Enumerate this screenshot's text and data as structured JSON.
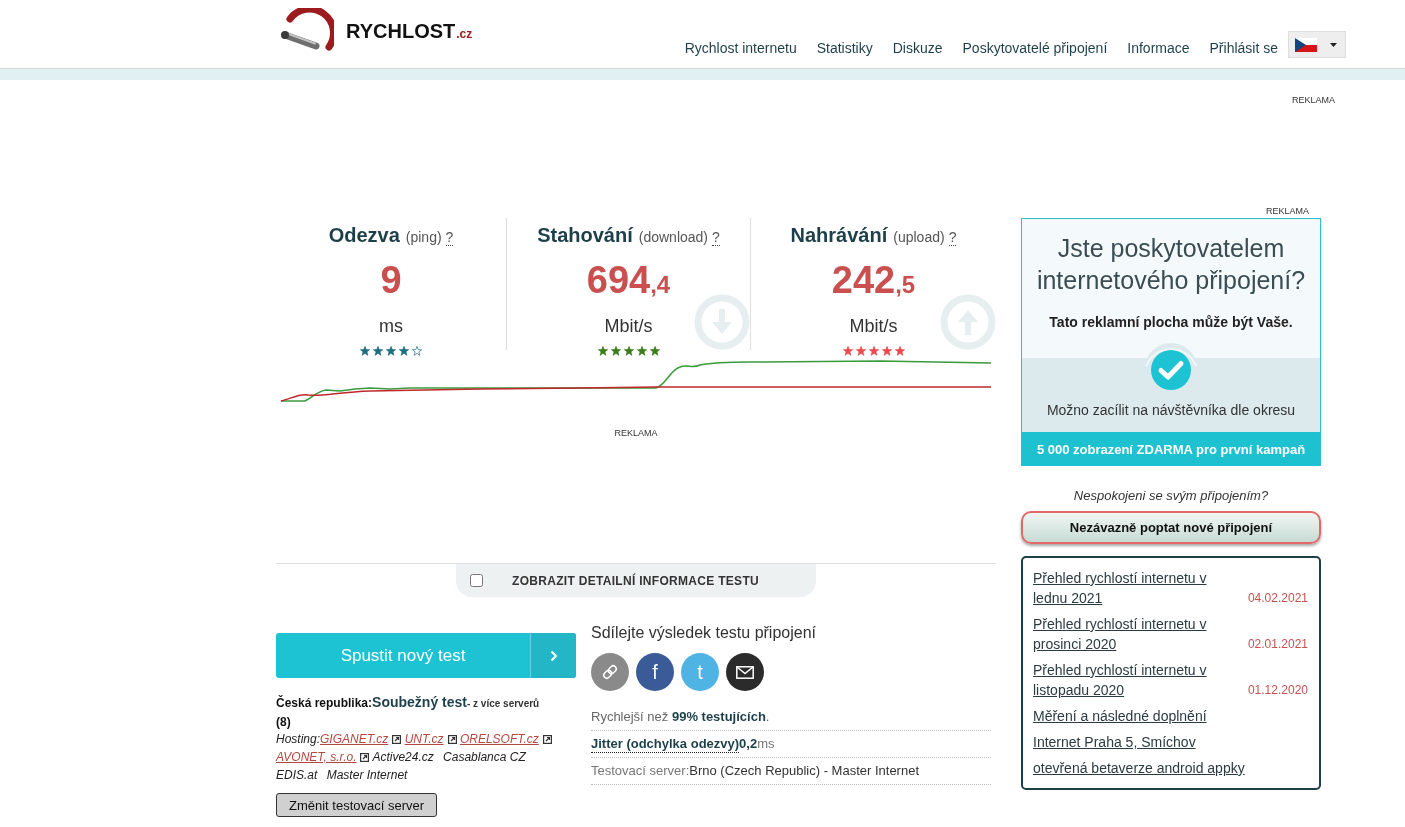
{
  "header": {
    "logo": "RYCHLOST",
    "logo_domain": ".cz",
    "nav": [
      "Rychlost internetu",
      "Statistiky",
      "Diskuze",
      "Poskytovatelé připojení",
      "Informace",
      "Přihlásit se"
    ]
  },
  "top_ad": {
    "label": "REKLAMA"
  },
  "metrics": [
    {
      "kind": "ping",
      "title": "Odezva",
      "subtitle": "(ping)",
      "help": "?",
      "value": "9",
      "unit": "ms",
      "stars": 4
    },
    {
      "kind": "download",
      "title": "Stahování",
      "subtitle": "(download)",
      "help": "?",
      "value": "694",
      "decimal": ",4",
      "unit": "Mbit/s",
      "stars": 5
    },
    {
      "kind": "upload",
      "title": "Nahrávání",
      "subtitle": "(upload)",
      "help": "?",
      "value": "242",
      "decimal": ",5",
      "unit": "Mbit/s",
      "stars": 5
    }
  ],
  "graph_ad": {
    "label": "REKLAMA"
  },
  "details_toggle": {
    "label": "ZOBRAZIT DETAILNÍ INFORMACE TESTU",
    "checked": false
  },
  "start_button": {
    "label": "Spustit nový test"
  },
  "server_info": {
    "country": "Česká republika:",
    "test": "Soubežný test",
    "note": "- z více serverů",
    "count": "(8)",
    "hosting_label": "Hosting:",
    "hosts": [
      {
        "name": "GIGANET.cz",
        "link": true
      },
      {
        "name": "UNT.cz",
        "link": true
      },
      {
        "name": "ORELSOFT.cz",
        "link": true
      },
      {
        "name": "AVONET, s.r.o.",
        "link": true
      },
      {
        "name": "Active24.cz",
        "link": false
      },
      {
        "name": "Casablanca CZ",
        "link": false
      },
      {
        "name": "EDIS.at",
        "link": false
      },
      {
        "name": "Master Internet",
        "link": false
      }
    ]
  },
  "change_server_button": {
    "label": "Změnit testovací server"
  },
  "share": {
    "title": "Sdílejte výsledek testu připojení",
    "buttons": [
      {
        "kind": "link"
      },
      {
        "kind": "facebook",
        "label": "f"
      },
      {
        "kind": "twitter",
        "label": "t"
      },
      {
        "kind": "email"
      }
    ]
  },
  "results": {
    "faster": "Rychlejší než **99% testujících**.",
    "jitter_label": "Jitter (odchylka odezvy)",
    "jitter_value": "0,2",
    "jitter_unit": "ms",
    "server_label": "Testovací server:",
    "server_value": "Brno (Czech Republic) - Master Internet"
  },
  "side_ad": {
    "label": "REKLAMA",
    "title": "Jste poskytovatelem internetového připojení?",
    "subtitle": "Tato reklamní plocha může být Vaše.",
    "feature": "Možno zacílit na návštěvníka dle okresu",
    "offer": "5 000 zobrazení ZDARMA pro první kampaň"
  },
  "inquiry": {
    "question": "Nespokojeni se svým připojením?",
    "button": "Nezávazně poptat nové připojení"
  },
  "news": [
    {
      "title": "Přehled rychlostí internetu v lednu 2021",
      "date": "04.02.2021"
    },
    {
      "title": "Přehled rychlostí internetu v prosinci 2020",
      "date": "02.01.2021"
    },
    {
      "title": "Přehled rychlostí internetu v listopadu 2020",
      "date": "01.12.2020"
    },
    {
      "title": "Měření a následné doplnění"
    },
    {
      "title": "Internet Praha 5, Smíchov"
    },
    {
      "title": "otevřená betaverze android appky"
    }
  ]
}
